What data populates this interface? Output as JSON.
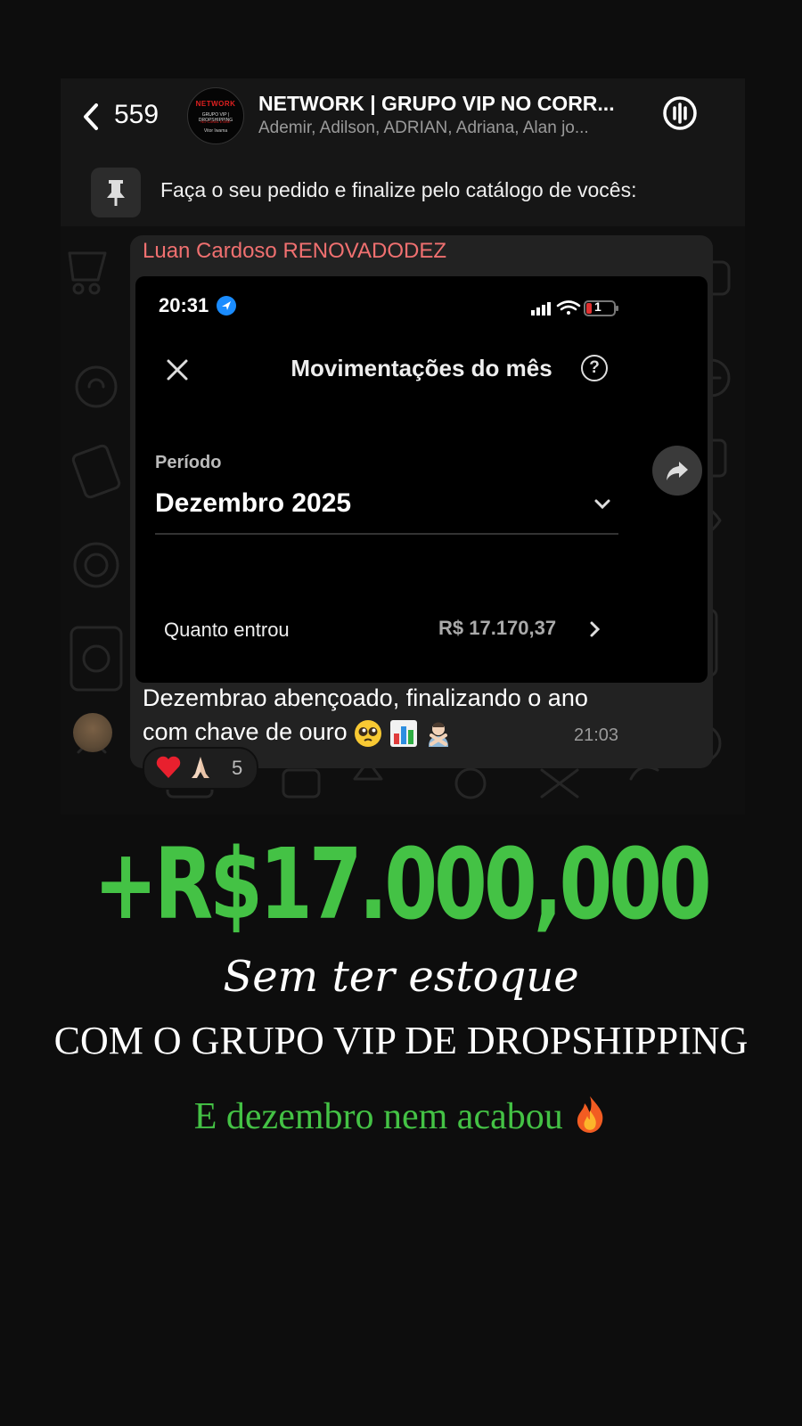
{
  "chat": {
    "back_count": "559",
    "group_title": "NETWORK | GRUPO VIP NO CORR...",
    "group_members": "Ademir, Adilson, ADRIAN, Adriana, Alan jo...",
    "group_avatar": {
      "line1": "NETWORK",
      "line2": "GRUPO VIP | DROPSHIPPING",
      "line3": "NO CANAL EXIBE",
      "line4": "Vitor Iwama"
    },
    "pinned_message": "Faça o seu pedido e finalize pelo catálogo de vocês:",
    "message": {
      "sender": "Luan Cardoso RENOVADODEZ",
      "text_line1": "Dezembrao abençoado, finalizando o ano",
      "text_line2": "com chave de ouro",
      "emojis": [
        "pleading-face",
        "bar-chart",
        "man-gesturing-no"
      ],
      "time": "21:03",
      "reactions": {
        "icons": [
          "red-heart",
          "folded-hands"
        ],
        "count": "5"
      },
      "screenshot": {
        "status_time": "20:31",
        "battery": "1",
        "title": "Movimentações do mês",
        "period_label": "Período",
        "period_value": "Dezembro 2025",
        "income_label": "Quanto entrou",
        "income_value": "R$ 17.170,37"
      }
    }
  },
  "promo": {
    "headline": "+R$17.000,000",
    "subtitle": "Sem ter estoque",
    "tagline": "COM O GRUPO VIP DE DROPSHIPPING",
    "footer": "E dezembro nem acabou"
  },
  "colors": {
    "accent_green": "#44c245",
    "sender_name": "#f07070",
    "background": "#0d0d0d"
  }
}
